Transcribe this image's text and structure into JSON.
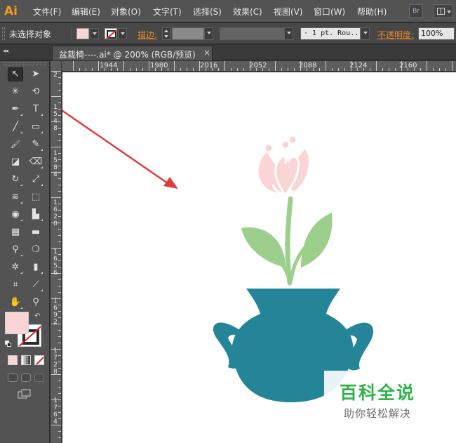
{
  "app": {
    "logo": "Ai"
  },
  "menu": [
    "文件(F)",
    "编辑(E)",
    "对象(O)",
    "文字(T)",
    "选择(S)",
    "效果(C)",
    "视图(V)",
    "窗口(W)",
    "帮助(H)"
  ],
  "menu_right": {
    "bridge_label": "Br"
  },
  "control_bar": {
    "selection_status": "未选择对象",
    "stroke_label": "描边:",
    "stroke_profile": "· 1 pt. Rou...",
    "opacity_label": "不透明度:",
    "opacity_value": "100%",
    "fill_color": "#fbd5d5"
  },
  "document_tab": {
    "title": "盆栽椅----.ai* @ 200% (RGB/预览)",
    "close_glyph": "×"
  },
  "panel_collapse_glyph": "◂◂",
  "tools": [
    {
      "name": "selection-tool-icon",
      "glyph": "↖",
      "active": true
    },
    {
      "name": "direct-selection-tool-icon",
      "glyph": "➤"
    },
    {
      "name": "magic-wand-tool-icon",
      "glyph": "✳"
    },
    {
      "name": "lasso-tool-icon",
      "glyph": "⟲"
    },
    {
      "name": "pen-tool-icon",
      "glyph": "✒"
    },
    {
      "name": "type-tool-icon",
      "glyph": "T"
    },
    {
      "name": "line-tool-icon",
      "glyph": "╱"
    },
    {
      "name": "rectangle-tool-icon",
      "glyph": "▭"
    },
    {
      "name": "paintbrush-tool-icon",
      "glyph": "🖌"
    },
    {
      "name": "pencil-tool-icon",
      "glyph": "✎"
    },
    {
      "name": "blob-brush-tool-icon",
      "glyph": "◪"
    },
    {
      "name": "eraser-tool-icon",
      "glyph": "⌫"
    },
    {
      "name": "rotate-tool-icon",
      "glyph": "↻"
    },
    {
      "name": "scale-tool-icon",
      "glyph": "⤢"
    },
    {
      "name": "warp-tool-icon",
      "glyph": "≋"
    },
    {
      "name": "free-transform-tool-icon",
      "glyph": "⬚"
    },
    {
      "name": "shape-builder-tool-icon",
      "glyph": "◉"
    },
    {
      "name": "perspective-grid-tool-icon",
      "glyph": "▙"
    },
    {
      "name": "mesh-tool-icon",
      "glyph": "▦"
    },
    {
      "name": "gradient-tool-icon",
      "glyph": "▬"
    },
    {
      "name": "eyedropper-tool-icon",
      "glyph": "⚲"
    },
    {
      "name": "blend-tool-icon",
      "glyph": "❍"
    },
    {
      "name": "symbol-sprayer-tool-icon",
      "glyph": "✲"
    },
    {
      "name": "column-graph-tool-icon",
      "glyph": "▮"
    },
    {
      "name": "artboard-tool-icon",
      "glyph": "⌗"
    },
    {
      "name": "slice-tool-icon",
      "glyph": "⟋"
    },
    {
      "name": "hand-tool-icon",
      "glyph": "✋"
    },
    {
      "name": "zoom-tool-icon",
      "glyph": "⚲"
    }
  ],
  "swap_glyph": "↶",
  "ruler": {
    "h_labels": [
      "1944",
      "1980",
      "2016",
      "2052",
      "2088",
      "2124",
      "2160"
    ],
    "v_labels": [
      "2",
      "1",
      "5",
      "4",
      "8",
      "1",
      "5",
      "8",
      "4",
      "1",
      "6",
      "2",
      "0",
      "1",
      "6",
      "5",
      "6",
      "1",
      "6",
      "9",
      "2",
      "1",
      "7",
      "2",
      "8",
      "1",
      "7",
      "6",
      "4"
    ]
  },
  "artwork_colors": {
    "flower": "#fbd5d5",
    "flower_outline": "#ffffff",
    "leaves": "#9dcf8c",
    "vase": "#248598",
    "arrow": "#e03c3c"
  },
  "watermark": {
    "title": "百科全说",
    "subtitle": "助你轻松解决"
  }
}
